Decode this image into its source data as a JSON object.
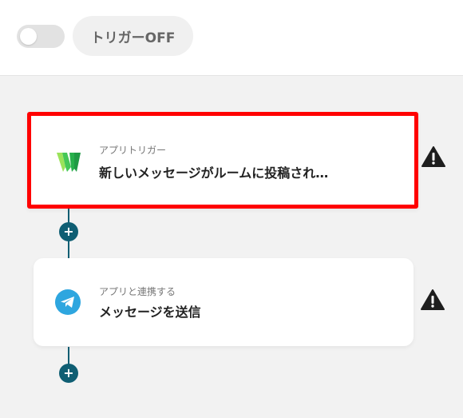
{
  "header": {
    "toggle_state": "off",
    "trigger_label": "トリガーOFF"
  },
  "flow": {
    "steps": [
      {
        "subtitle": "アプリトリガー",
        "title": "新しいメッセージがルームに投稿され…",
        "icon": "chatwork-logo-icon",
        "selected": true,
        "warning": true
      },
      {
        "subtitle": "アプリと連携する",
        "title": "メッセージを送信",
        "icon": "telegram-icon",
        "selected": false,
        "warning": true
      }
    ],
    "add_step_glyph": "+"
  },
  "colors": {
    "connector": "#0f5e73",
    "selection_border": "#ff0000",
    "background": "#f2f2f2"
  }
}
